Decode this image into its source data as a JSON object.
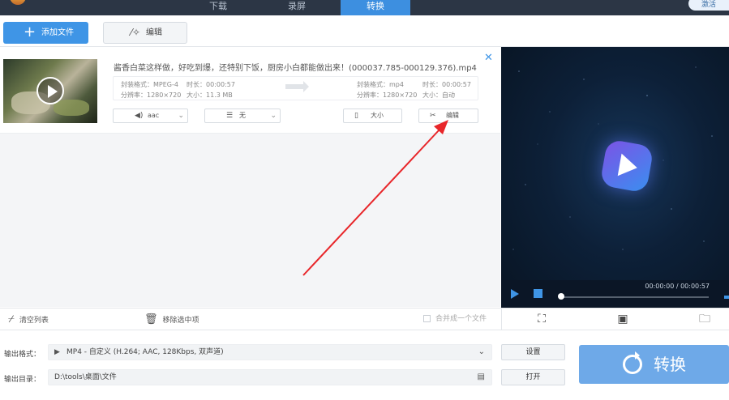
{
  "nav": {
    "tabs": [
      {
        "label": "下载"
      },
      {
        "label": "录屏"
      },
      {
        "label": "转换",
        "active": true
      }
    ],
    "login_label": "激活"
  },
  "toolbar": {
    "add_file_label": "添加文件",
    "edit_label": "编辑"
  },
  "file": {
    "name": "酱香白菜这样做，好吃到爆，还特别下饭，厨房小白都能做出来！(000037.785-000129.376).mp4",
    "source": {
      "format": "封装格式：MPEG-4",
      "duration": "时长：00:00:57",
      "resolution": "分辨率：1280×720",
      "size": "大小：11.3 MB"
    },
    "target": {
      "format": "封装格式：mp4",
      "duration": "时长：00:00:57",
      "resolution": "分辨率：1280×720",
      "size": "大小：自动"
    },
    "audio_select": "aac",
    "subtitle_select": "无",
    "size_button": "大小",
    "edit_button": "编辑"
  },
  "preview": {
    "time": "00:00:00 / 00:00:57",
    "progress": 0.0
  },
  "actions": {
    "clear_list": "清空列表",
    "remove_selected": "移除选中项",
    "merge_label": "合并成一个文件"
  },
  "output": {
    "format_label": "输出格式：",
    "format_value": "MP4 - 自定义 (H.264; AAC, 128Kbps, 双声道)",
    "dir_label": "输出目录：",
    "dir_value": "D:\\tools\\桌面\\文件",
    "settings_button": "设置",
    "open_button": "打开",
    "convert_button": "转换"
  },
  "colors": {
    "accent": "#3f95e6",
    "topbar": "#2c3645",
    "annotation": "#e8262a",
    "convert": "#6ea9e8"
  }
}
